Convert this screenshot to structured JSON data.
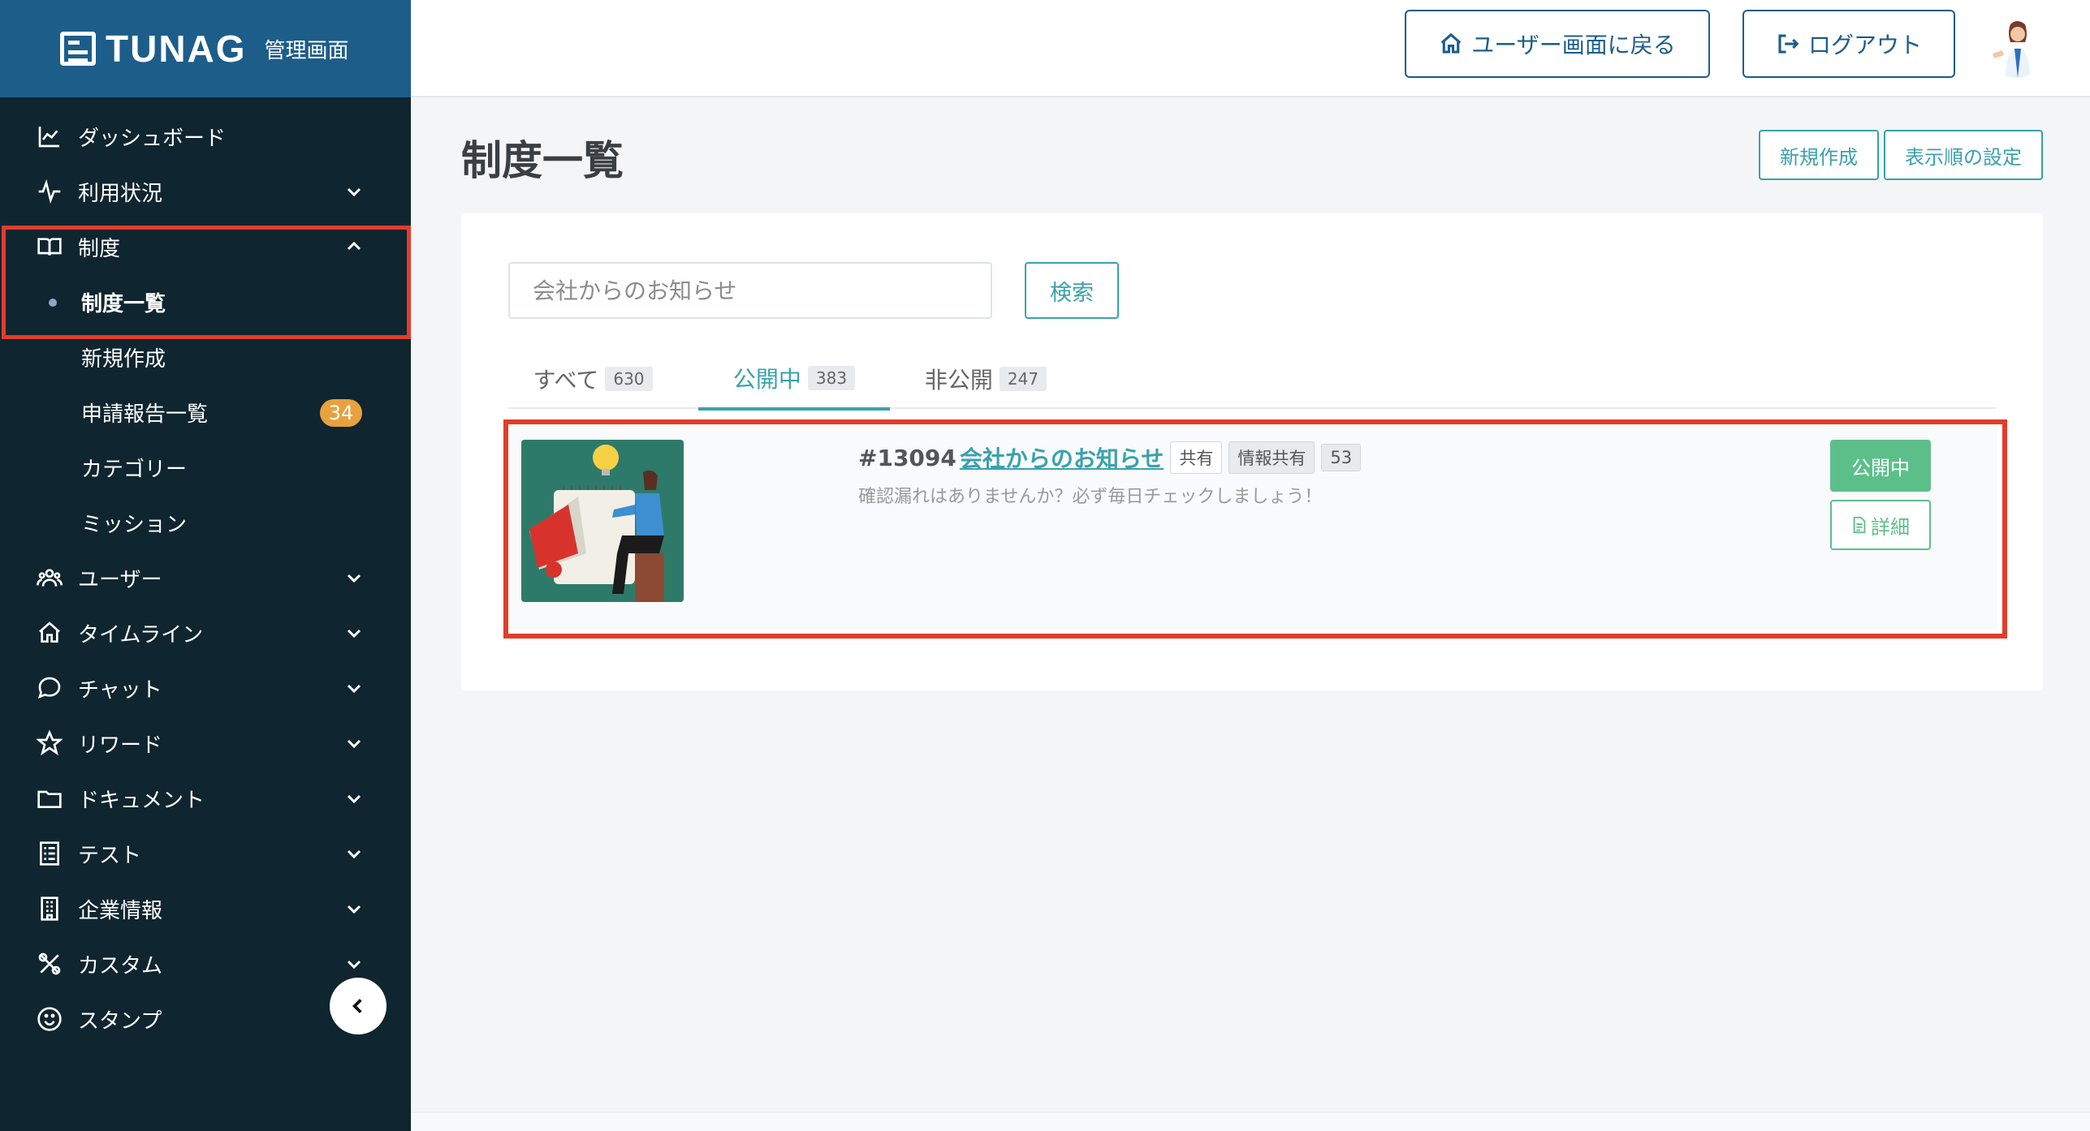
{
  "app": {
    "logo_text": "TUNAG",
    "logo_sub": "管理画面"
  },
  "sidebar": {
    "items": [
      {
        "label": "ダッシュボード",
        "icon": "chart-line-icon"
      },
      {
        "label": "利用状況",
        "icon": "activity-icon"
      },
      {
        "label": "制度",
        "icon": "book-open-icon"
      },
      {
        "label": "ユーザー",
        "icon": "users-icon"
      },
      {
        "label": "タイムライン",
        "icon": "home-icon"
      },
      {
        "label": "チャット",
        "icon": "chat-bubble-icon"
      },
      {
        "label": "リワード",
        "icon": "star-icon"
      },
      {
        "label": "ドキュメント",
        "icon": "folder-icon"
      },
      {
        "label": "テスト",
        "icon": "checklist-icon"
      },
      {
        "label": "企業情報",
        "icon": "building-icon"
      },
      {
        "label": "カスタム",
        "icon": "tools-icon"
      },
      {
        "label": "スタンプ",
        "icon": "smile-icon"
      }
    ],
    "sub_items": [
      {
        "label": "制度一覧"
      },
      {
        "label": "新規作成"
      },
      {
        "label": "申請報告一覧",
        "badge": "34"
      },
      {
        "label": "カテゴリー"
      },
      {
        "label": "ミッション"
      }
    ]
  },
  "topbar": {
    "back_label": "ユーザー画面に戻る",
    "logout_label": "ログアウト"
  },
  "main": {
    "title": "制度一覧",
    "new_button": "新規作成",
    "order_button": "表示順の設定",
    "search_placeholder": "会社からのお知らせ",
    "search_button": "検索",
    "tabs": [
      {
        "label": "すべて",
        "count": "630"
      },
      {
        "label": "公開中",
        "count": "383"
      },
      {
        "label": "非公開",
        "count": "247"
      }
    ],
    "item": {
      "number": "#13094",
      "name": "会社からのお知らせ",
      "tag1": "共有",
      "tag2": "情報共有",
      "tag3": "53",
      "description": "確認漏れはありませんか？必ず毎日チェックしましょう！",
      "status": "公開中",
      "detail": "詳細"
    }
  },
  "colors": {
    "sidebar_bg": "#0f2530",
    "header_blue": "#1d5d8a",
    "accent_teal": "#3aa1ac",
    "status_green": "#5cbf8a",
    "highlight_red": "#e23c2b",
    "badge_orange": "#e7a13e"
  }
}
